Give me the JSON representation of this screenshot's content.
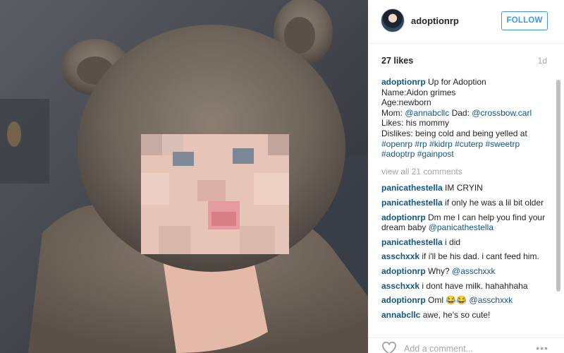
{
  "post": {
    "photo_alt": "Photo of a baby in a brown fuzzy bear-ear hood"
  },
  "header": {
    "username": "adoptionrp",
    "follow_label": "FOLLOW"
  },
  "stats": {
    "likes": "27 likes",
    "age": "1d"
  },
  "caption": {
    "username": "adoptionrp",
    "lines": [
      "Up for Adoption",
      "Name:Aidon grimes",
      "Age:newborn"
    ],
    "mom_prefix": "Mom: ",
    "mom_mention": "@annabcllc",
    "dad_prefix": " Dad: ",
    "dad_mention": "@crossbow.carl",
    "likes_line": "Likes: his mommy",
    "dislikes_line": "Dislikes: being cold and being yelled at",
    "tags_line1": [
      "#openrp",
      "#rp",
      "#kidrp",
      "#cuterp",
      "#sweetrp"
    ],
    "tags_line2": [
      "#adoptrp",
      "#gainpost"
    ]
  },
  "view_all": "view all 21 comments",
  "comments": [
    {
      "user": "panicathestella",
      "text": "IM CRYIN"
    },
    {
      "user": "panicathestella",
      "text": "if only he was a lil bit older"
    },
    {
      "user": "adoptionrp",
      "text": "Dm me I can help you find your dream baby ",
      "mention": "@panicathestella"
    },
    {
      "user": "panicathestella",
      "text": "i did"
    },
    {
      "user": "asschxxk",
      "text": "if i'll be his dad. i cant feed him."
    },
    {
      "user": "adoptionrp",
      "text": "Why? ",
      "mention": "@asschxxk"
    },
    {
      "user": "asschxxk",
      "text": "i dont have milk. hahahhaha"
    },
    {
      "user": "adoptionrp",
      "text": "Oml 😂😂 ",
      "mention": "@asschxxk"
    },
    {
      "user": "annabcllc",
      "text": "awe, he's so cute!"
    }
  ],
  "footer": {
    "add_comment_placeholder": "Add a comment...",
    "more_label": "•••"
  },
  "colors": {
    "link": "#125688",
    "follow": "#3897f0",
    "muted": "#a5a7aa"
  },
  "icons": {
    "like": "heart-outline-icon",
    "more": "more-dots-icon"
  }
}
